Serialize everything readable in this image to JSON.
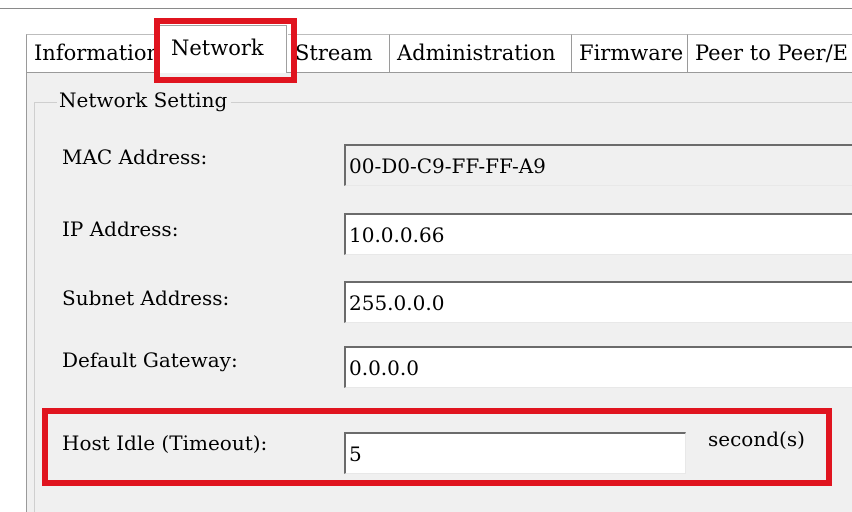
{
  "tabs": [
    {
      "label": "Information"
    },
    {
      "label": "Network"
    },
    {
      "label": "Stream"
    },
    {
      "label": "Administration"
    },
    {
      "label": "Firmware"
    },
    {
      "label": "Peer to Peer/E"
    }
  ],
  "active_tab": "Network",
  "network_setting": {
    "legend": "Network Setting",
    "mac": {
      "label": "MAC Address:",
      "value": "00-D0-C9-FF-FF-A9"
    },
    "ip": {
      "label": "IP Address:",
      "value": "10.0.0.66"
    },
    "subnet": {
      "label": "Subnet Address:",
      "value": "255.0.0.0"
    },
    "gateway": {
      "label": "Default Gateway:",
      "value": "0.0.0.0"
    },
    "timeout": {
      "label": "Host Idle (Timeout):",
      "value": "5",
      "unit": "second(s)"
    }
  },
  "colors": {
    "highlight": "#e0141f",
    "panel": "#f0f0f0"
  }
}
